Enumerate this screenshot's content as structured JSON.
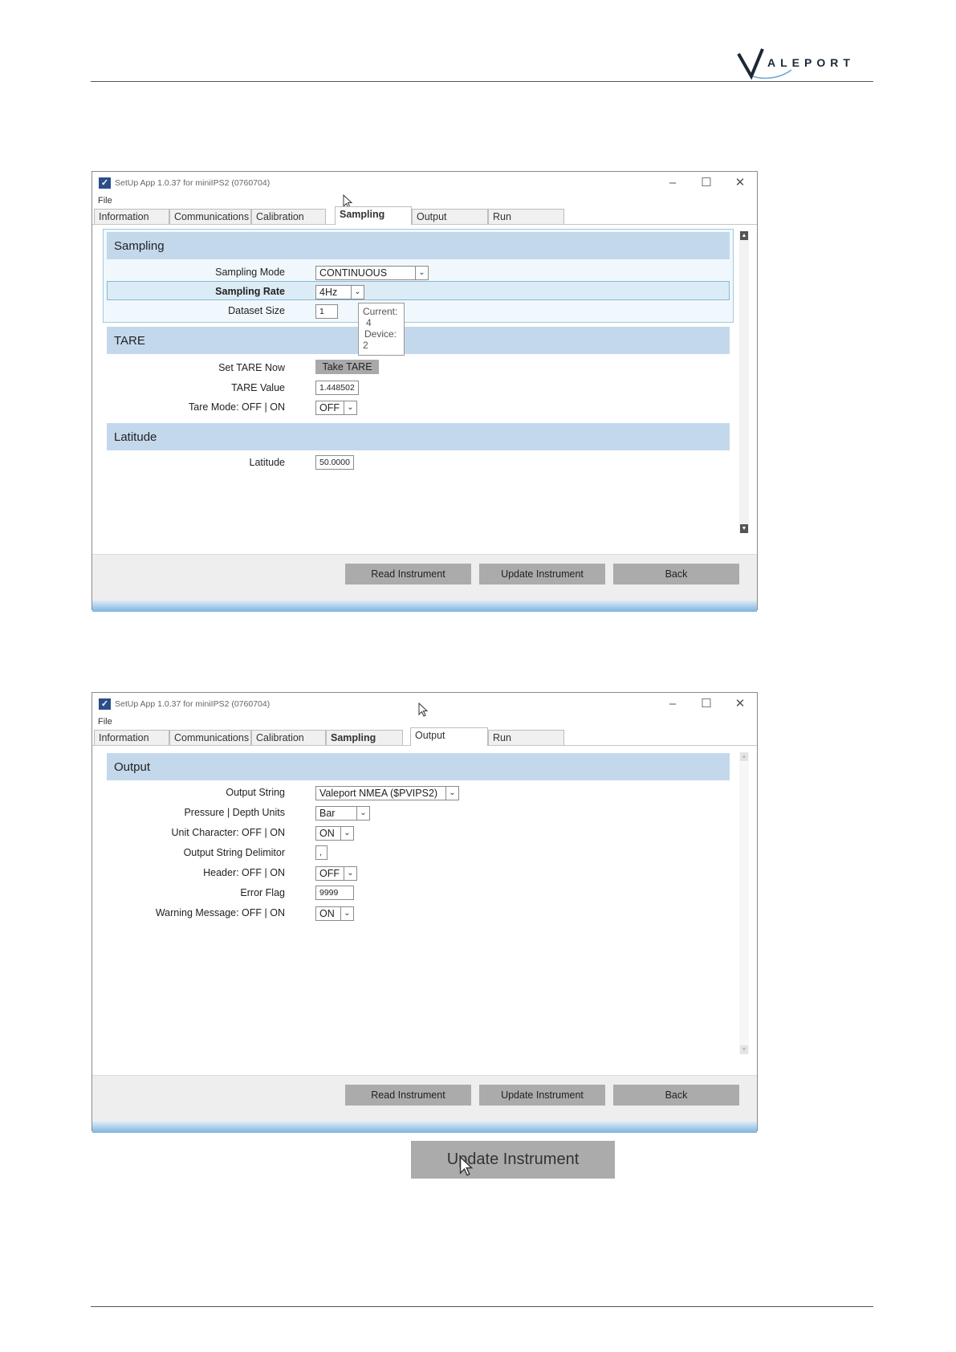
{
  "header": {
    "logo_text": "ALEPORT",
    "logo_initial": "V"
  },
  "window1": {
    "title": "SetUp App 1.0.37 for miniIPS2 (0760704)",
    "menu_file": "File",
    "tabs": [
      "Information",
      "Communications",
      "Calibration",
      "Sampling",
      "Output",
      "Run"
    ],
    "active_tab": "Sampling",
    "sampling": {
      "heading": "Sampling",
      "mode_label": "Sampling Mode",
      "mode_value": "CONTINUOUS",
      "rate_label": "Sampling Rate",
      "rate_value": "4Hz",
      "dataset_label": "Dataset Size",
      "dataset_value": "1",
      "tooltip_l1": "Current:",
      "tooltip_l2": "4",
      "tooltip_l3": "Device:",
      "tooltip_l4": "2"
    },
    "tare": {
      "heading": "TARE",
      "set_label": "Set TARE Now",
      "take_button": "Take TARE",
      "value_label": "TARE Value",
      "value": "1.448502",
      "mode_label": "Tare Mode: OFF | ON",
      "mode_value": "OFF"
    },
    "latitude": {
      "heading": "Latitude",
      "label": "Latitude",
      "value": "50.0000"
    },
    "buttons": {
      "read": "Read Instrument",
      "update": "Update Instrument",
      "back": "Back"
    }
  },
  "window2": {
    "title": "SetUp App 1.0.37 for miniIPS2 (0760704)",
    "menu_file": "File",
    "tabs": [
      "Information",
      "Communications",
      "Calibration",
      "Sampling",
      "Output",
      "Run"
    ],
    "active_tab": "Output",
    "output": {
      "heading": "Output",
      "string_label": "Output String",
      "string_value": "Valeport NMEA ($PVIPS2)",
      "units_label": "Pressure | Depth Units",
      "units_value": "Bar",
      "unitchar_label": "Unit Character: OFF | ON",
      "unitchar_value": "ON",
      "delim_label": "Output String Delimitor",
      "delim_value": ",",
      "header_label": "Header: OFF | ON",
      "header_value": "OFF",
      "errflag_label": "Error Flag",
      "errflag_value": "9999",
      "warn_label": "Warning Message: OFF | ON",
      "warn_value": "ON"
    },
    "buttons": {
      "read": "Read Instrument",
      "update": "Update Instrument",
      "back": "Back"
    }
  },
  "zoom_button": "Update Instrument"
}
